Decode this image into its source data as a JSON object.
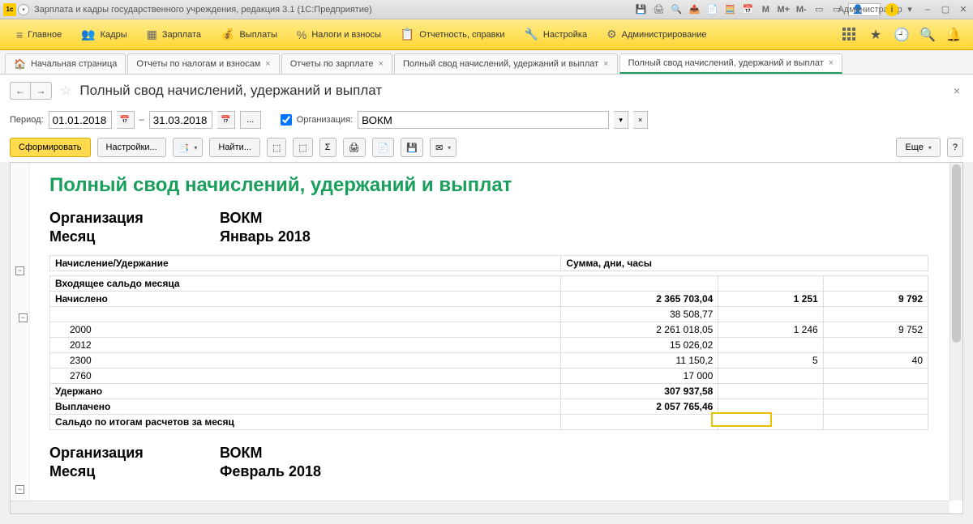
{
  "titlebar": {
    "title": "Зарплата и кадры государственного учреждения, редакция 3.1  (1С:Предприятие)",
    "admin": "Администратор"
  },
  "menu": {
    "items": [
      "Главное",
      "Кадры",
      "Зарплата",
      "Выплаты",
      "Налоги и взносы",
      "Отчетность, справки",
      "Настройка",
      "Администрирование"
    ]
  },
  "tabs": {
    "home": "Начальная страница",
    "t1": "Отчеты по налогам и взносам",
    "t2": "Отчеты по зарплате",
    "t3": "Полный свод начислений, удержаний и выплат",
    "t4": "Полный свод начислений, удержаний и выплат"
  },
  "page": {
    "title": "Полный свод начислений, удержаний и выплат"
  },
  "filter": {
    "periodLabel": "Период:",
    "from": "01.01.2018",
    "dash": "–",
    "to": "31.03.2018",
    "orgLabel": "Организация:",
    "orgValue": "ВОКМ"
  },
  "toolbar": {
    "form": "Сформировать",
    "settings": "Настройки...",
    "find": "Найти...",
    "more": "Еще"
  },
  "report": {
    "title": "Полный свод начислений, удержаний и выплат",
    "orgLabel": "Организация",
    "monthLabel": "Месяц",
    "org1": "ВОКМ",
    "month1": "Январь 2018",
    "col1": "Начисление/Удержание",
    "col2": "Сумма, дни, часы",
    "rows": {
      "incoming": "Входящее сальдо месяца",
      "accrued": "Начислено",
      "accrued_sum": "2 365 703,04",
      "accrued_c2": "1 251",
      "accrued_c3": "9 792",
      "r2_sum": "38 508,77",
      "r3_code": "2000",
      "r3_sum": "2 261 018,05",
      "r3_c2": "1 246",
      "r3_c3": "9 752",
      "r4_code": "2012",
      "r4_sum": "15 026,02",
      "r5_code": "2300",
      "r5_sum": "11 150,2",
      "r5_c2": "5",
      "r5_c3": "40",
      "r6_code": "2760",
      "r6_sum": "17 000",
      "withheld": "Удержано",
      "withheld_sum": "307 937,58",
      "paid": "Выплачено",
      "paid_sum": "2 057 765,46",
      "balance": "Сальдо по итогам расчетов за месяц"
    },
    "org2": "ВОКМ",
    "month2": "Февраль 2018"
  }
}
